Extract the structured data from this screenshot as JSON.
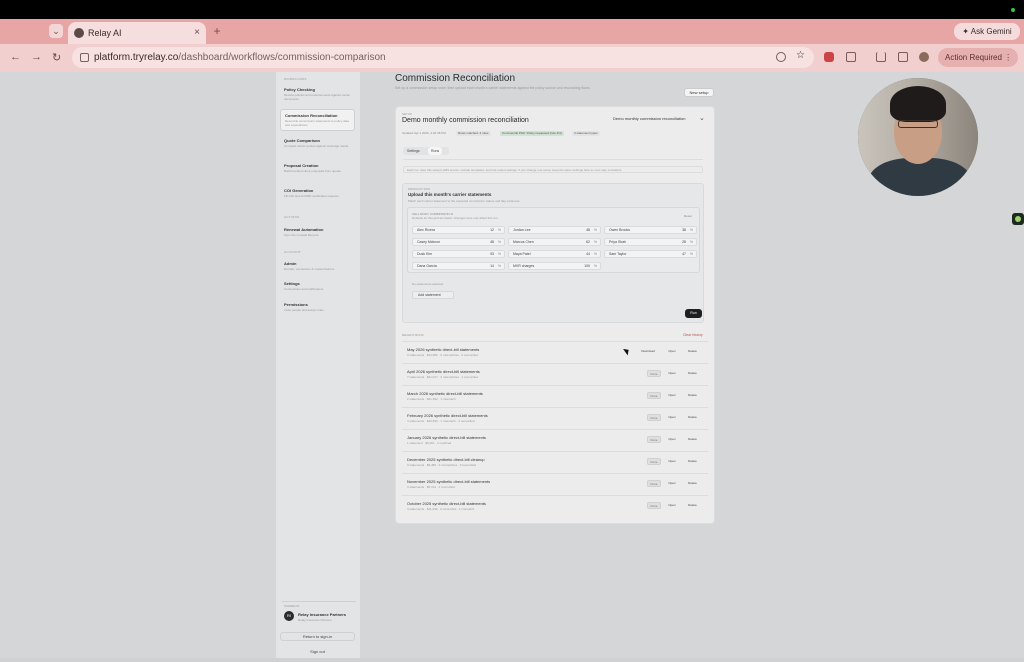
{
  "browser": {
    "tab_title": "Relay AI",
    "new_tab": "+",
    "tab_close": "×",
    "ask_gemini": "Ask Gemini",
    "url_host": "platform.tryrelay.co",
    "url_path": "/dashboard/workflows/commission-comparison",
    "action_required": "Action Required",
    "nav": {
      "back": "←",
      "forward": "→",
      "reload": "↻"
    }
  },
  "sidebar": {
    "section_workflows": "WORKFLOWS",
    "section_actions": "ACTIONS",
    "section_account": "ACCOUNT",
    "items": [
      {
        "title": "Policy Checking",
        "sub": "Review policies and endorsements against carrier documents"
      },
      {
        "title": "Commission Reconciliation",
        "sub": "Reconcile commission statements to policy data and expectations"
      },
      {
        "title": "Quote Comparison",
        "sub": "Compare carrier quotes against coverage needs"
      },
      {
        "title": "Proposal Creation",
        "sub": "Build branded client proposals from quotes"
      },
      {
        "title": "COI Generation",
        "sub": "Fill COI and ACORD certificates requests"
      },
      {
        "title": "Renewal Automation",
        "sub": "Sync the renewal lifecycle"
      },
      {
        "title": "Admin",
        "sub": "Domain, connectors & customizations"
      },
      {
        "title": "Settings",
        "sub": "Connections and notifications"
      },
      {
        "title": "Permissions",
        "sub": "Invite people and assign roles"
      }
    ],
    "workspace_label": "SIGNED IN",
    "workspace_initials": "RI",
    "workspace_name": "Relay Insurance Partners",
    "workspace_sub": "Relay Insurance Partners",
    "return_signin": "Return to sign-in",
    "sign_out": "Sign out"
  },
  "main": {
    "title": "Commission Reconciliation",
    "subtitle": "Set up a commission setup once, then upload each month's carrier statements against the policy source and reconciling flows.",
    "new_setup": "New setup"
  },
  "card": {
    "label": "SETUP",
    "title": "Demo monthly commission reconciliation",
    "select_value": "Demo monthly commission reconciliation",
    "meta": "Updated Apr 1 2026, 4:32:48 PM",
    "pills": [
      "Rows matched: 4 rules",
      "Commercial P&C: Policy requested (rule 4/4)",
      "3 statement types"
    ],
    "tabs": [
      "Settings",
      "Runs"
    ],
    "intro": "Each run uses this setup's AMS source, include templates, and rule output settings. If you change one setup, keep the same settings here so runs stay consistent.",
    "upload_label": "PRODUCT RUN",
    "upload_title": "Upload this month's carrier statements",
    "upload_sub": "Match each carrier statement to the expected commission values and flag variances.",
    "grid_h1": "CELL ROW / COMMISSION %",
    "grid_h2": "Defaults for this grid are blank. Changes here only affect this run.",
    "grid_reset": "Reset",
    "cells": [
      {
        "name": "Alex Rivera",
        "value": "12",
        "unit": "%"
      },
      {
        "name": "Casey Mcknon",
        "value": "48",
        "unit": "%"
      },
      {
        "name": "Dusk Kim",
        "value": "93",
        "unit": "%"
      },
      {
        "name": "Dana Garcia",
        "value": "14",
        "unit": "%"
      },
      {
        "name": "Jordan Lee",
        "value": "48",
        "unit": "%"
      },
      {
        "name": "Marcus Chen",
        "value": "62",
        "unit": "%"
      },
      {
        "name": "Maya Patel",
        "value": "44",
        "unit": "%"
      },
      {
        "name": "MVR charges",
        "value": "100",
        "unit": "%"
      },
      {
        "name": "Owen Brooks",
        "value": "38",
        "unit": "%"
      },
      {
        "name": "Priya Shah",
        "value": "28",
        "unit": "%"
      },
      {
        "name": "Sam Taylor",
        "value": "47",
        "unit": "%"
      }
    ],
    "no_statements": "No statements selected",
    "add_statement": "Add statement",
    "run_button": "Run"
  },
  "recent": {
    "label": "RECENT RUNS",
    "clear_history": "Clear history",
    "runs": [
      {
        "title": "May 2026 synthetic direct-bill statements",
        "sub": "3 statements · $13,980 · 0 mismatches · 0 reconciled",
        "status": "Download"
      },
      {
        "title": "April 2026 synthetic direct-bill statements",
        "sub": "7 statements · $21,017 · 3 mismatches · 1 reconciled",
        "status": "Done"
      },
      {
        "title": "March 2026 synthetic direct-bill statements",
        "sub": "2 statements · $21,302 · 1 mismatch",
        "status": "Done"
      },
      {
        "title": "February 2026 synthetic direct-bill statements",
        "sub": "4 statements · $19,593 · 1 mismatch · 2 reconciled",
        "status": "Done"
      },
      {
        "title": "January 2026 synthetic direct-bill statements",
        "sub": "1 statement · $6,261 · 1 matched",
        "status": "Done"
      },
      {
        "title": "December 2025 synthetic direct-bill cleanup",
        "sub": "3 statements · $9,486 · 0 mismatches · 0 reconciled",
        "status": "Done"
      },
      {
        "title": "November 2025 synthetic direct-bill statements",
        "sub": "3 statements · $5,314 · 1 reconciled",
        "status": "Done"
      },
      {
        "title": "October 2025 synthetic direct-bill statements",
        "sub": "4 statements · $11,230 · 0 reconciled · 1 mismatch",
        "status": "Done"
      }
    ],
    "open_label": "Open",
    "delete_label": "Delete"
  }
}
